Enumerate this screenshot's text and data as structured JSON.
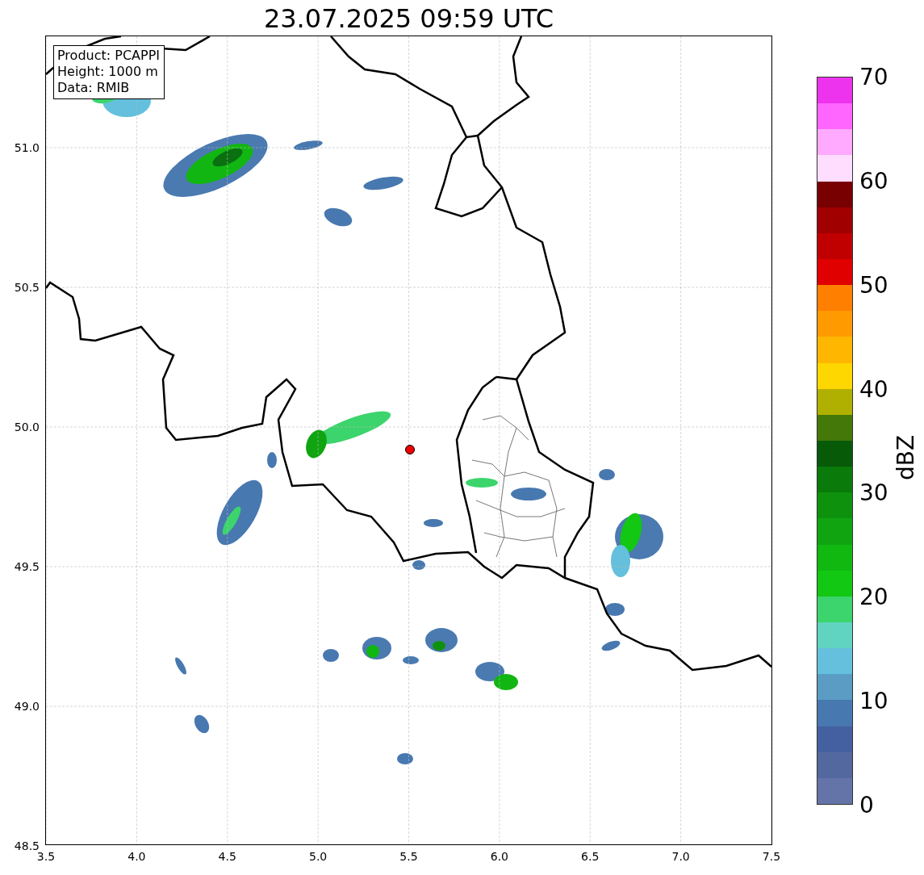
{
  "title": "23.07.2025 09:59 UTC",
  "info_box": [
    "Product: PCAPPI",
    "Height: 1000 m",
    "Data: RMIB"
  ],
  "map": {
    "x_ticks": [
      "3.5",
      "4.0",
      "4.5",
      "5.0",
      "5.5",
      "6.0",
      "6.5",
      "7.0",
      "7.5"
    ],
    "y_ticks": [
      "51.0",
      "50.5",
      "50.0",
      "49.5",
      "49.0",
      "48.5"
    ]
  },
  "colorbar": {
    "label": "dBZ",
    "ticks": [
      "70",
      "60",
      "50",
      "40",
      "30",
      "20",
      "10",
      "0"
    ],
    "bins": [
      {
        "color": "#6474a8"
      },
      {
        "color": "#5468a0"
      },
      {
        "color": "#4460a0"
      },
      {
        "color": "#4878b0"
      },
      {
        "color": "#5a9cc4"
      },
      {
        "color": "#64c0dc"
      },
      {
        "color": "#60d4c0"
      },
      {
        "color": "#3cd46c"
      },
      {
        "color": "#12c812"
      },
      {
        "color": "#10b810"
      },
      {
        "color": "#10a410"
      },
      {
        "color": "#0e920e"
      },
      {
        "color": "#0a7a0a"
      },
      {
        "color": "#065a08"
      },
      {
        "color": "#447808"
      },
      {
        "color": "#b0b000"
      },
      {
        "color": "#ffd700"
      },
      {
        "color": "#ffb600"
      },
      {
        "color": "#ff9a00"
      },
      {
        "color": "#ff7f00"
      },
      {
        "color": "#e00000"
      },
      {
        "color": "#c00000"
      },
      {
        "color": "#a00000"
      },
      {
        "color": "#780000"
      },
      {
        "color": "#ffddff"
      },
      {
        "color": "#ffaaff"
      },
      {
        "color": "#ff66ff"
      },
      {
        "color": "#ee33ee"
      }
    ]
  }
}
